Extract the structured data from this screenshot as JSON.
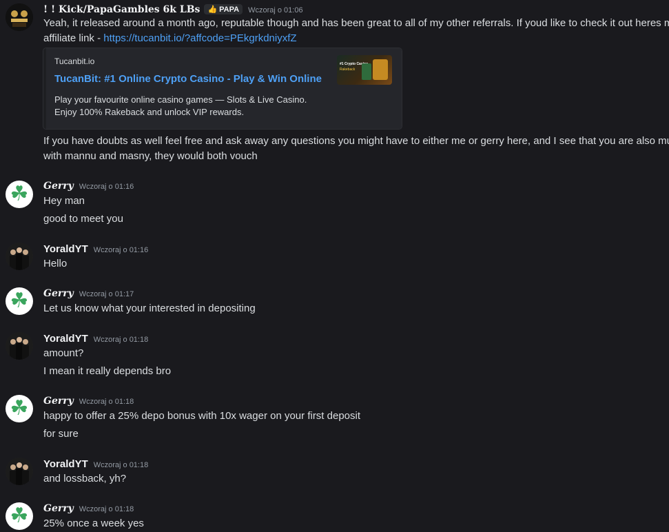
{
  "messages": [
    {
      "username": "! ! Kick/PapaGambles 6k LBs",
      "tag": {
        "icon": "thumbs-up-icon",
        "label": "PAPA"
      },
      "timestamp": "Wczoraj o 01:06",
      "lines": [
        "Yeah, it released around a month ago, reputable though and has been great to all of my other referrals. If youd like to check it out heres my",
        "affiliate link - "
      ],
      "link": "https://tucanbit.io/?affcode=PEkgrkdniyxfZ",
      "embed": {
        "provider": "Tucanbit.io",
        "title": "TucanBit: #1 Online Crypto Casino - Play & Win Online",
        "description_1": "Play your favourite online casino games — Slots & Live Casino.",
        "description_2": "Enjoy 100% Rakeback and unlock VIP rewards.",
        "thumb_text_1": "#1 Crypto Casino",
        "thumb_text_2": "Rakeback"
      },
      "after_lines": [
        "If you have doubts as well feel free and ask away any questions you might have to either me or gerry here, and I see that you are also mutuals",
        "with mannu and masny, they would both vouch"
      ]
    },
    {
      "username": "Gerry",
      "timestamp": "Wczoraj o 01:16",
      "lines": [
        "Hey man",
        "good to meet you"
      ]
    },
    {
      "username": "YoraldYT",
      "timestamp": "Wczoraj o 01:16",
      "lines": [
        "Hello"
      ]
    },
    {
      "username": "Gerry",
      "timestamp": "Wczoraj o 01:17",
      "lines": [
        "Let us know what your interested in depositing"
      ]
    },
    {
      "username": "YoraldYT",
      "timestamp": "Wczoraj o 01:18",
      "lines": [
        "amount?",
        "I mean it really depends bro"
      ]
    },
    {
      "username": "Gerry",
      "timestamp": "Wczoraj o 01:18",
      "lines": [
        "happy to offer a 25% depo bonus with 10x wager on your first deposit",
        "for sure"
      ]
    },
    {
      "username": "YoraldYT",
      "timestamp": "Wczoraj o 01:18",
      "lines": [
        "and lossback, yh?"
      ]
    },
    {
      "username": "Gerry",
      "timestamp": "Wczoraj o 01:18",
      "lines": [
        "25% once a week yes"
      ]
    }
  ],
  "avatars": {
    "papa": "papagambles-logo",
    "gerry": "clover-icon",
    "yorald": "group-photo"
  },
  "colors": {
    "background": "#1a1a1e",
    "link": "#4ea0f5",
    "clover": "#3aa55d"
  }
}
